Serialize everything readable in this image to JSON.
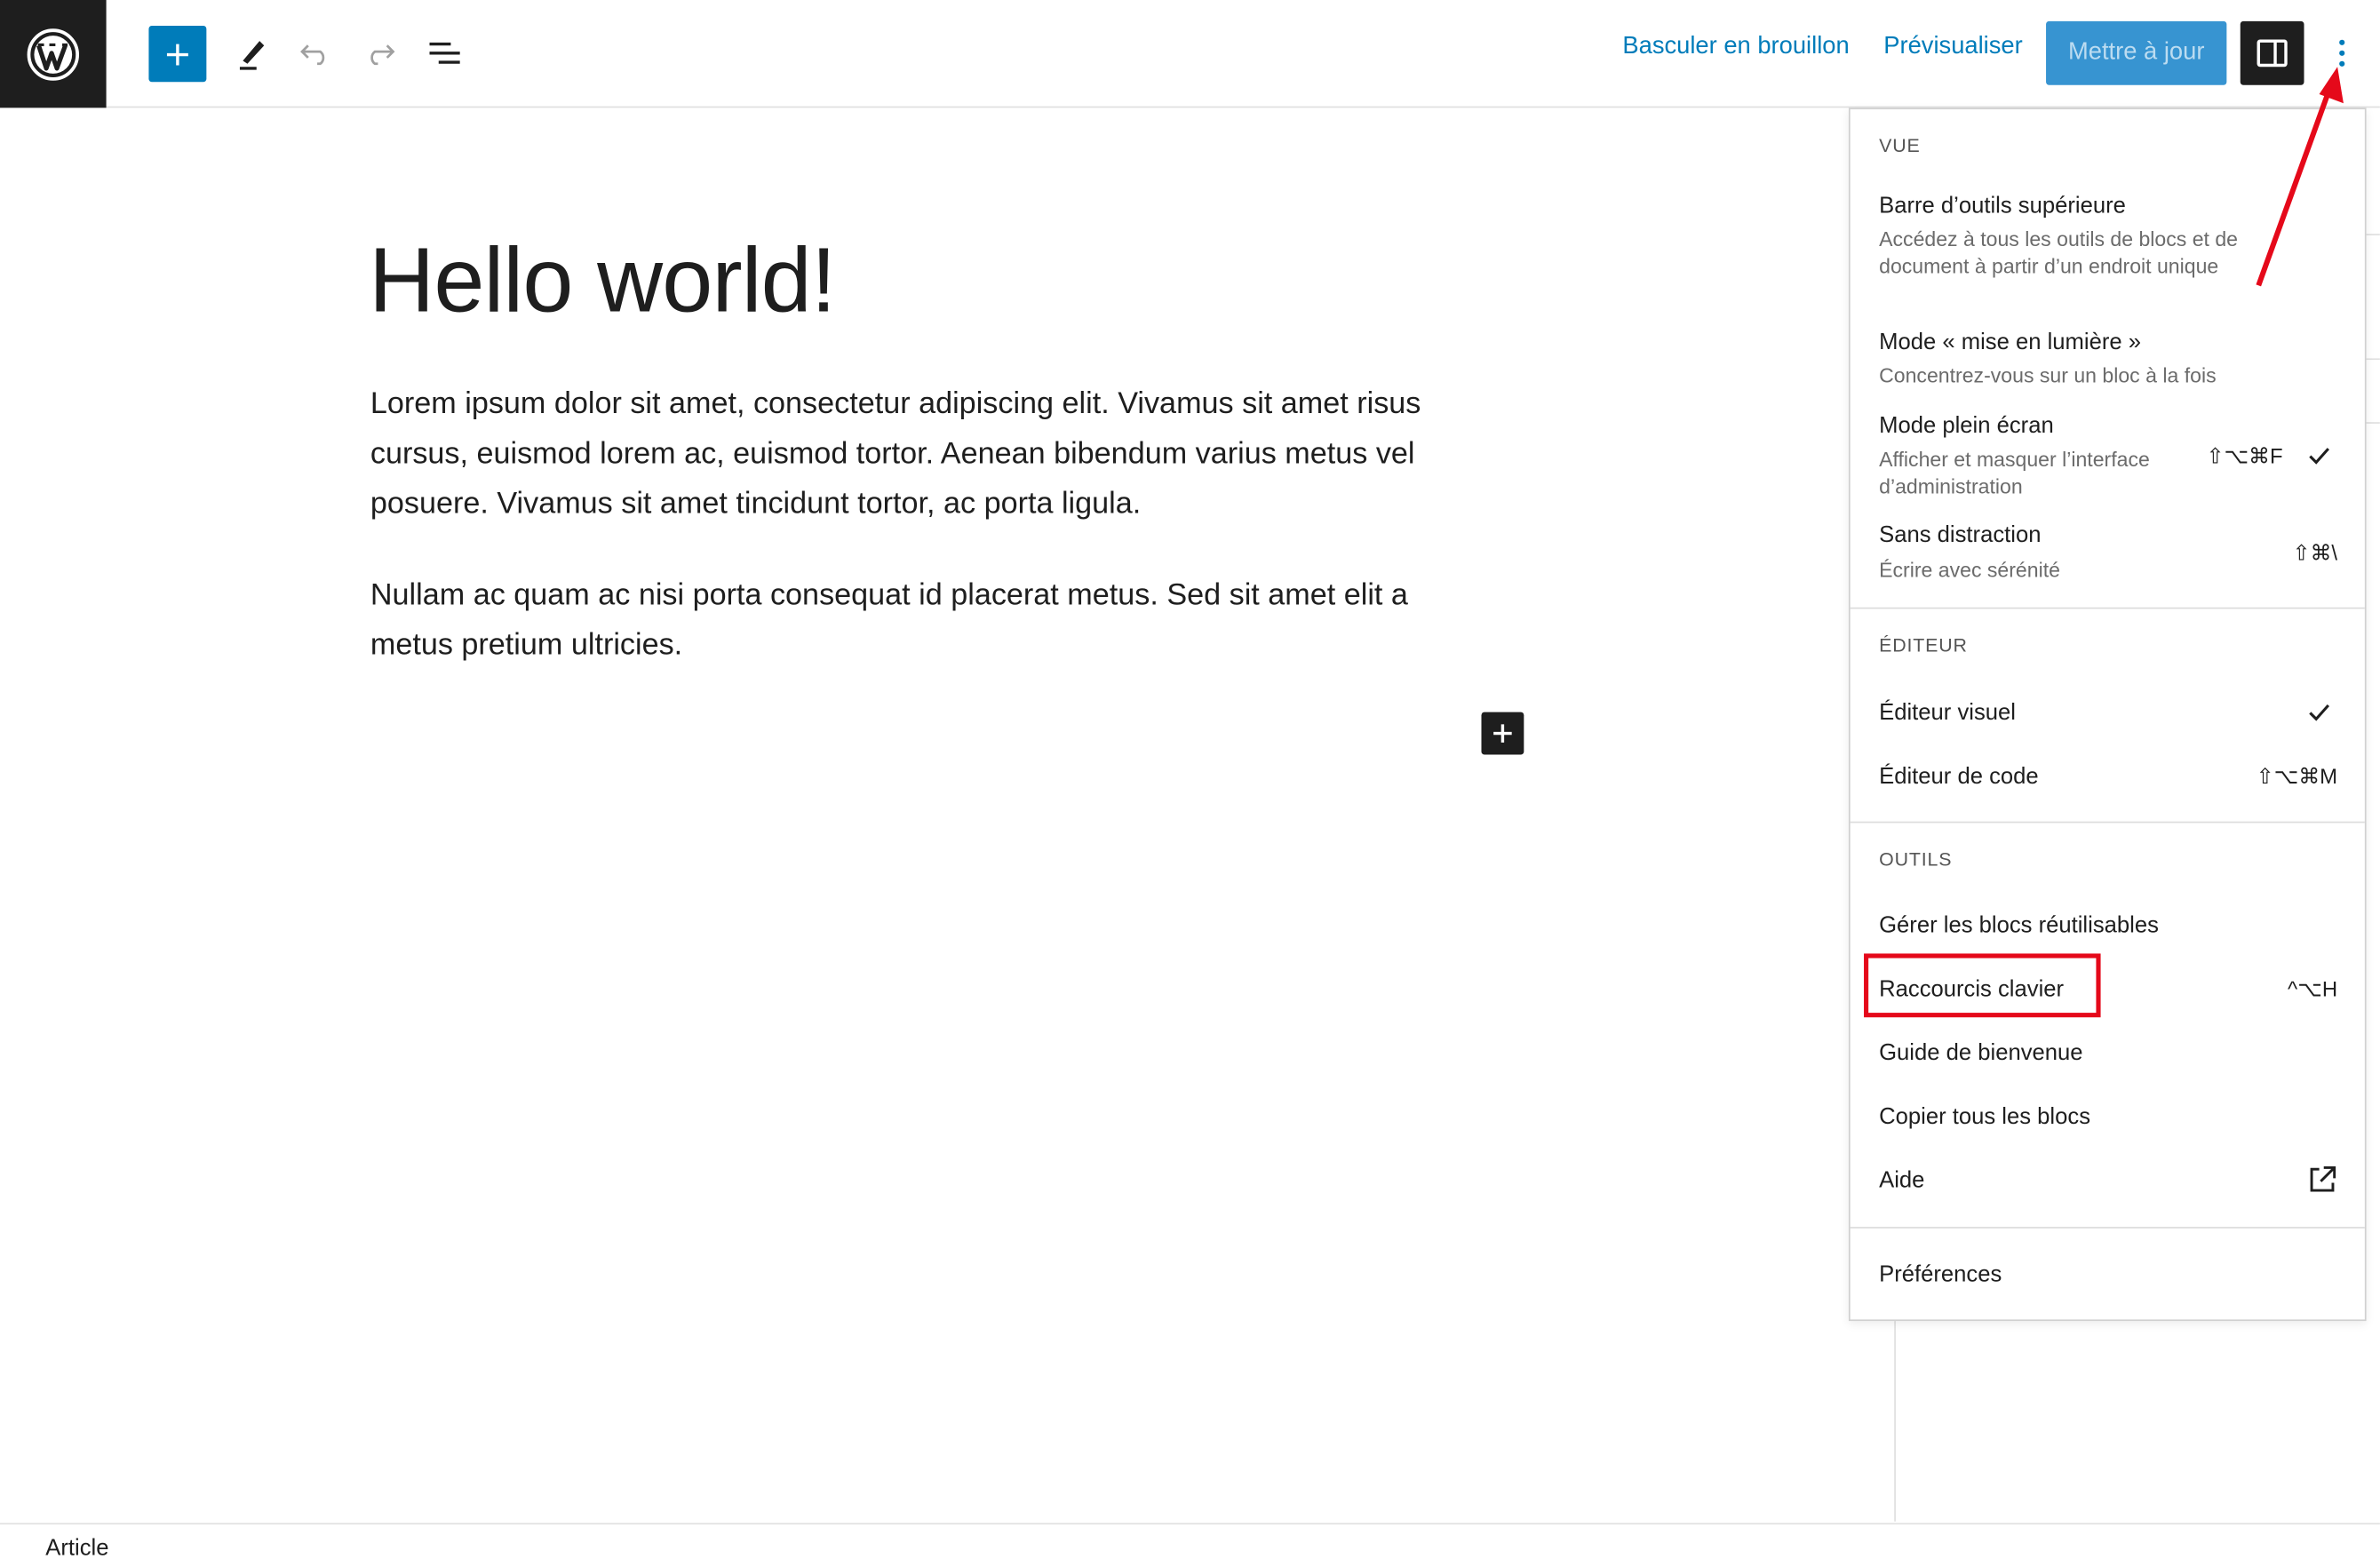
{
  "toolbar": {
    "draft_label": "Basculer en brouillon",
    "preview_label": "Prévisualiser",
    "update_label": "Mettre à jour"
  },
  "post": {
    "title": "Hello world!",
    "paragraphs": [
      "Lorem ipsum dolor sit amet, consectetur adipiscing elit. Vivamus sit amet risus cursus, euismod lorem ac, euismod tortor. Aenean bibendum varius metus vel posuere. Vivamus sit amet tincidunt tortor, ac porta ligula.",
      "Nullam ac quam ac nisi porta consequat id placerat metus. Sed sit amet elit a metus pretium ultricies."
    ]
  },
  "footer": {
    "breadcrumb": "Article"
  },
  "menu": {
    "view": {
      "label": "Vue",
      "items": [
        {
          "title": "Barre d’outils supérieure",
          "desc": "Accédez à tous les outils de blocs et de document à partir d’un endroit unique"
        },
        {
          "title": "Mode « mise en lumière »",
          "desc": "Concentrez-vous sur un bloc à la fois"
        },
        {
          "title": "Mode plein écran",
          "desc": "Afficher et masquer l’interface d’administration",
          "shortcut": "⇧⌥⌘F",
          "checked": true
        },
        {
          "title": "Sans distraction",
          "desc": "Écrire avec sérénité",
          "shortcut": "⇧⌘\\"
        }
      ]
    },
    "editor": {
      "label": "Éditeur",
      "items": [
        {
          "title": "Éditeur visuel",
          "checked": true
        },
        {
          "title": "Éditeur de code",
          "shortcut": "⇧⌥⌘M"
        }
      ]
    },
    "tools": {
      "label": "Outils",
      "items": [
        {
          "title": "Gérer les blocs réutilisables"
        },
        {
          "title": "Raccourcis clavier",
          "shortcut": "^⌥H"
        },
        {
          "title": "Guide de bienvenue"
        },
        {
          "title": "Copier tous les blocs"
        },
        {
          "title": "Aide",
          "icon": "external-link-icon"
        }
      ]
    },
    "preferences_label": "Préférences"
  },
  "colors": {
    "accent": "#007cba",
    "annotation": "#e5091a",
    "dark": "#1e1e1e"
  }
}
